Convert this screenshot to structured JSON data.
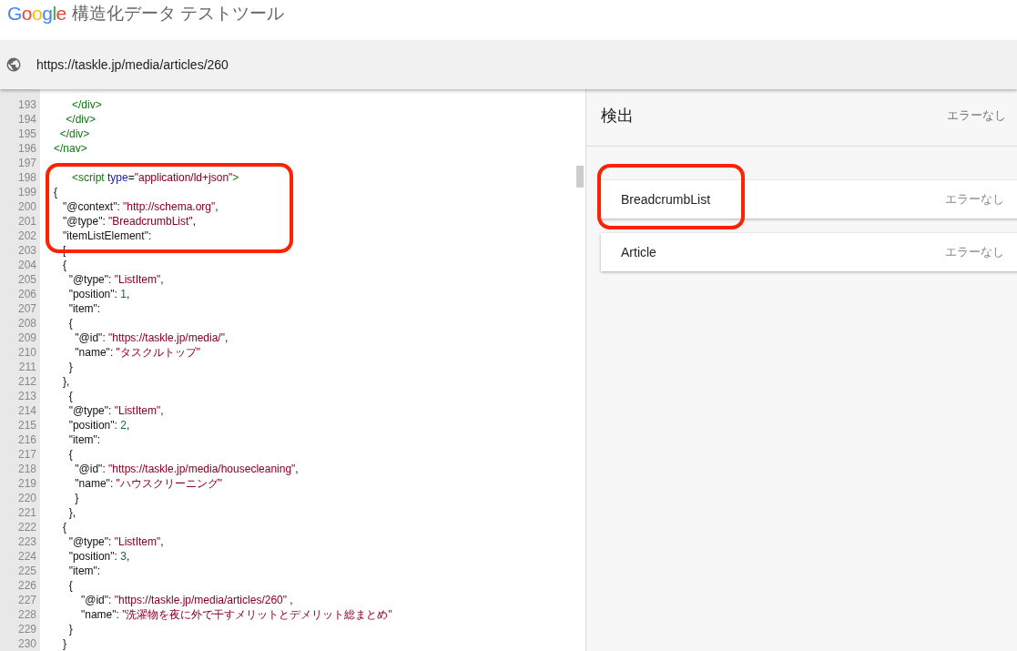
{
  "header": {
    "logo": "Google",
    "title": "構造化データ テストツール"
  },
  "url_bar": {
    "value": "https://taskle.jp/media/articles/260"
  },
  "code": {
    "lines": [
      {
        "number": "193",
        "tokens": [
          {
            "text": "      </div>",
            "kind": "tag"
          }
        ]
      },
      {
        "number": "194",
        "tokens": [
          {
            "text": "    </div>",
            "kind": "tag"
          }
        ]
      },
      {
        "number": "195",
        "tokens": [
          {
            "text": "  </div>",
            "kind": "tag"
          }
        ]
      },
      {
        "number": "196",
        "tokens": [
          {
            "text": "</nav>",
            "kind": "tag"
          }
        ]
      },
      {
        "number": "197"
      },
      {
        "number": "198",
        "tokens": [
          {
            "text": "      <script",
            "kind": "tag"
          },
          {
            "text": " type",
            "kind": "attr"
          },
          {
            "text": "=",
            "kind": "plain"
          },
          {
            "text": "\"application/ld+json\"",
            "kind": "string"
          },
          {
            "text": ">",
            "kind": "tag"
          }
        ]
      },
      {
        "number": "199",
        "tokens": [
          {
            "text": "{",
            "kind": "plain"
          }
        ]
      },
      {
        "number": "200",
        "tokens": [
          {
            "text": "   \"@context\": ",
            "kind": "plain"
          },
          {
            "text": "\"http://schema.org\"",
            "kind": "string"
          },
          {
            "text": ",",
            "kind": "plain"
          }
        ]
      },
      {
        "number": "201",
        "tokens": [
          {
            "text": "   \"@type\": ",
            "kind": "plain"
          },
          {
            "text": "\"BreadcrumbList\"",
            "kind": "string"
          },
          {
            "text": ",",
            "kind": "plain"
          }
        ]
      },
      {
        "number": "202",
        "tokens": [
          {
            "text": "   \"itemListElement\":",
            "kind": "plain"
          }
        ]
      },
      {
        "number": "203",
        "tokens": [
          {
            "text": "   [",
            "kind": "plain"
          }
        ]
      },
      {
        "number": "204",
        "tokens": [
          {
            "text": "   {",
            "kind": "plain"
          }
        ]
      },
      {
        "number": "205",
        "tokens": [
          {
            "text": "     \"@type\": ",
            "kind": "plain"
          },
          {
            "text": "\"ListItem\"",
            "kind": "string"
          },
          {
            "text": ",",
            "kind": "plain"
          }
        ]
      },
      {
        "number": "206",
        "tokens": [
          {
            "text": "     \"position\": ",
            "kind": "plain"
          },
          {
            "text": "1",
            "kind": "number"
          },
          {
            "text": ",",
            "kind": "plain"
          }
        ]
      },
      {
        "number": "207",
        "tokens": [
          {
            "text": "     \"item\":",
            "kind": "plain"
          }
        ]
      },
      {
        "number": "208",
        "tokens": [
          {
            "text": "     {",
            "kind": "plain"
          }
        ]
      },
      {
        "number": "209",
        "tokens": [
          {
            "text": "       \"@id\": ",
            "kind": "plain"
          },
          {
            "text": "\"https://taskle.jp/media/\"",
            "kind": "string"
          },
          {
            "text": ",",
            "kind": "plain"
          }
        ]
      },
      {
        "number": "210",
        "tokens": [
          {
            "text": "       \"name\": ",
            "kind": "plain"
          },
          {
            "text": "\"タスクルトップ\"",
            "kind": "string"
          }
        ]
      },
      {
        "number": "211",
        "tokens": [
          {
            "text": "     }",
            "kind": "plain"
          }
        ]
      },
      {
        "number": "212",
        "tokens": [
          {
            "text": "   },",
            "kind": "plain"
          }
        ]
      },
      {
        "number": "213",
        "tokens": [
          {
            "text": "     {",
            "kind": "plain"
          }
        ]
      },
      {
        "number": "214",
        "tokens": [
          {
            "text": "     \"@type\": ",
            "kind": "plain"
          },
          {
            "text": "\"ListItem\"",
            "kind": "string"
          },
          {
            "text": ",",
            "kind": "plain"
          }
        ]
      },
      {
        "number": "215",
        "tokens": [
          {
            "text": "     \"position\": ",
            "kind": "plain"
          },
          {
            "text": "2",
            "kind": "number"
          },
          {
            "text": ",",
            "kind": "plain"
          }
        ]
      },
      {
        "number": "216",
        "tokens": [
          {
            "text": "     \"item\":",
            "kind": "plain"
          }
        ]
      },
      {
        "number": "217",
        "tokens": [
          {
            "text": "     {",
            "kind": "plain"
          }
        ]
      },
      {
        "number": "218",
        "tokens": [
          {
            "text": "       \"@id\": ",
            "kind": "plain"
          },
          {
            "text": "\"https://taskle.jp/media/housecleaning\"",
            "kind": "string"
          },
          {
            "text": ",",
            "kind": "plain"
          }
        ]
      },
      {
        "number": "219",
        "tokens": [
          {
            "text": "       \"name\": ",
            "kind": "plain"
          },
          {
            "text": "\"ハウスクリーニング\"",
            "kind": "string"
          }
        ]
      },
      {
        "number": "220",
        "tokens": [
          {
            "text": "       }",
            "kind": "plain"
          }
        ]
      },
      {
        "number": "221",
        "tokens": [
          {
            "text": "     },",
            "kind": "plain"
          }
        ]
      },
      {
        "number": "222",
        "tokens": [
          {
            "text": "   {",
            "kind": "plain"
          }
        ]
      },
      {
        "number": "223",
        "tokens": [
          {
            "text": "     \"@type\": ",
            "kind": "plain"
          },
          {
            "text": "\"ListItem\"",
            "kind": "string"
          },
          {
            "text": ",",
            "kind": "plain"
          }
        ]
      },
      {
        "number": "224",
        "tokens": [
          {
            "text": "     \"position\": ",
            "kind": "plain"
          },
          {
            "text": "3",
            "kind": "number"
          },
          {
            "text": ",",
            "kind": "plain"
          }
        ]
      },
      {
        "number": "225",
        "tokens": [
          {
            "text": "     \"item\":",
            "kind": "plain"
          }
        ]
      },
      {
        "number": "226",
        "tokens": [
          {
            "text": "     {",
            "kind": "plain"
          }
        ]
      },
      {
        "number": "227",
        "tokens": [
          {
            "text": "         \"@id\": ",
            "kind": "plain"
          },
          {
            "text": "\"https://taskle.jp/media/articles/260\"",
            "kind": "string"
          },
          {
            "text": " ,",
            "kind": "plain"
          }
        ]
      },
      {
        "number": "228",
        "tokens": [
          {
            "text": "         \"name\": ",
            "kind": "plain"
          },
          {
            "text": "\"洗濯物を夜に外で干すメリットとデメリット総まとめ\"",
            "kind": "string"
          }
        ]
      },
      {
        "number": "229",
        "tokens": [
          {
            "text": "     }",
            "kind": "plain"
          }
        ]
      },
      {
        "number": "230",
        "tokens": [
          {
            "text": "   }",
            "kind": "plain"
          }
        ]
      }
    ]
  },
  "results": {
    "title": "検出",
    "status": "エラーなし",
    "items": [
      {
        "name": "BreadcrumbList",
        "status": "エラーなし"
      },
      {
        "name": "Article",
        "status": "エラーなし"
      }
    ]
  }
}
